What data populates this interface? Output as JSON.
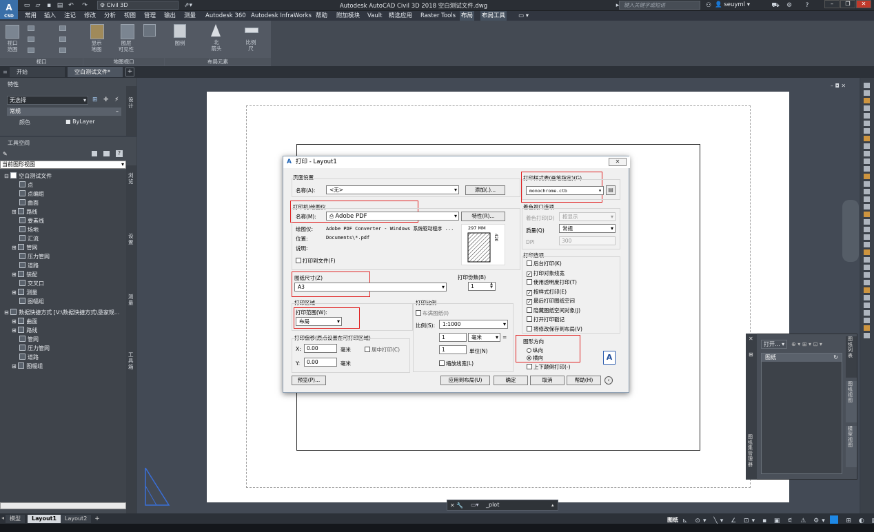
{
  "app": {
    "logo": "A",
    "logo_sub": "CSD",
    "workspace": "Civil 3D",
    "window_title": "Autodesk AutoCAD Civil 3D 2018    空白测试文件.dwg",
    "search_placeholder": "键入关键字或短语",
    "user": "seuyml"
  },
  "menu": [
    "常用",
    "插入",
    "注记",
    "修改",
    "分析",
    "视图",
    "管理",
    "输出",
    "测量",
    "Autodesk 360",
    "Autodesk InfraWorks",
    "帮助",
    "附加模块",
    "Vault",
    "精选应用",
    "Raster Tools",
    "布局",
    "布局工具"
  ],
  "ribbon": {
    "viewport_panel": "视口",
    "layout_viewport_panel": "地图视口",
    "layout_elements_panel": "布局元素",
    "btn_new_vp": "视口\n范围",
    "btn_show_map": "显示\n地图",
    "btn_layer_vis": "图层\n可见性",
    "btn_legend": "图例",
    "btn_north": "北\n箭头",
    "btn_scale": "比例\n尺"
  },
  "doc_tabs": [
    "开始",
    "空白测试文件*"
  ],
  "properties": {
    "title": "特性",
    "selection": "无选择",
    "section": "常规",
    "row_label": "颜色",
    "row_value": "ByLayer",
    "strip": "设计"
  },
  "toolspace": {
    "title": "工具空间",
    "view_select": "当前图形视图",
    "tree": [
      "空白测试文件",
      "点",
      "点编组",
      "曲面",
      "路线",
      "要素线",
      "场地",
      "汇流",
      "管网",
      "压力管网",
      "道路",
      "装配",
      "交叉口",
      "测量",
      "图幅组",
      "数据快捷方式 [V:\\数据快捷方式\\垦家规...",
      "曲面",
      "路线",
      "管网",
      "压力管网",
      "道路",
      "图幅组"
    ],
    "side_tabs": [
      "浏览",
      "设置",
      "测量",
      "工具箱"
    ]
  },
  "dialog": {
    "title": "打印 - Layout1",
    "page_setup": "页面设置",
    "name_label": "名称(A):",
    "name_value": "<无>",
    "add_btn": "添加(.)...",
    "printer_group": "打印机/绘图仪",
    "printer_name_label": "名称(M):",
    "printer_value": "Adobe PDF",
    "properties_btn": "特性(R)...",
    "plotter_label": "绘图仪:",
    "plotter_value": "Adobe PDF Converter - Windows 系统驱动程序 ...",
    "where_label": "位置:",
    "where_value": "Documents\\*.pdf",
    "desc_label": "说明:",
    "print_to_file": "打印到文件(F)",
    "preview_dim_w": "297 MM",
    "preview_dim_h": "420",
    "paper_size_label": "图纸尺寸(Z)",
    "paper_size_value": "A3",
    "copies_label": "打印份数(B)",
    "copies_value": "1",
    "plot_area_label": "打印区域",
    "plot_range_label": "打印范围(W):",
    "plot_range_value": "布局",
    "plot_offset_label": "打印偏移(原点设置在可打印区域)",
    "x_label": "X:",
    "x_value": "0.00",
    "y_label": "Y:",
    "y_value": "0.00",
    "unit_mm": "毫米",
    "center_plot": "居中打印(C)",
    "plot_scale_label": "打印比例",
    "fit_paper": "布满图纸(I)",
    "scale_label": "比例(S):",
    "scale_value": "1:1000",
    "scale_num": "1",
    "scale_unit": "毫米",
    "scale_eq": "=",
    "scale_den": "1",
    "unit_label": "单位(N)",
    "scale_lineweights": "缩放线宽(L)",
    "style_table_label": "打印样式表(画笔指定)(G)",
    "style_table_value": "monochrome.ctb",
    "shaded_label": "着色视口选项",
    "shade_plot_label": "着色打印(D)",
    "shade_plot_value": "按显示",
    "quality_label": "质量(Q)",
    "quality_value": "常规",
    "dpi_label": "DPI",
    "dpi_value": "300",
    "options_label": "打印选项",
    "options": [
      {
        "label": "后台打印(K)",
        "checked": false
      },
      {
        "label": "打印对象线宽",
        "checked": true
      },
      {
        "label": "使用透明度打印(T)",
        "checked": false
      },
      {
        "label": "按样式打印(E)",
        "checked": true
      },
      {
        "label": "最后打印图纸空间",
        "checked": true
      },
      {
        "label": "隐藏图纸空间对象(J)",
        "checked": false
      },
      {
        "label": "打开打印戳记",
        "checked": false
      },
      {
        "label": "将修改保存到布局(V)",
        "checked": false
      }
    ],
    "orient_label": "图形方向",
    "portrait": "纵向",
    "landscape": "横向",
    "upside_down": "上下颠倒打印(-)",
    "preview_btn": "预览(P)...",
    "apply_btn": "应用到布局(U)",
    "ok_btn": "确定",
    "cancel_btn": "取消",
    "help_btn": "帮助(H)"
  },
  "command": "_plot",
  "layout_tabs": [
    "模型",
    "Layout1",
    "Layout2"
  ],
  "status_model": "图纸",
  "sheetset": {
    "open_btn": "打开...",
    "header": "图纸",
    "side_tabs": [
      "图纸列表",
      "图纸视图",
      "模型视图"
    ],
    "left_tab": "图纸集管理器"
  }
}
